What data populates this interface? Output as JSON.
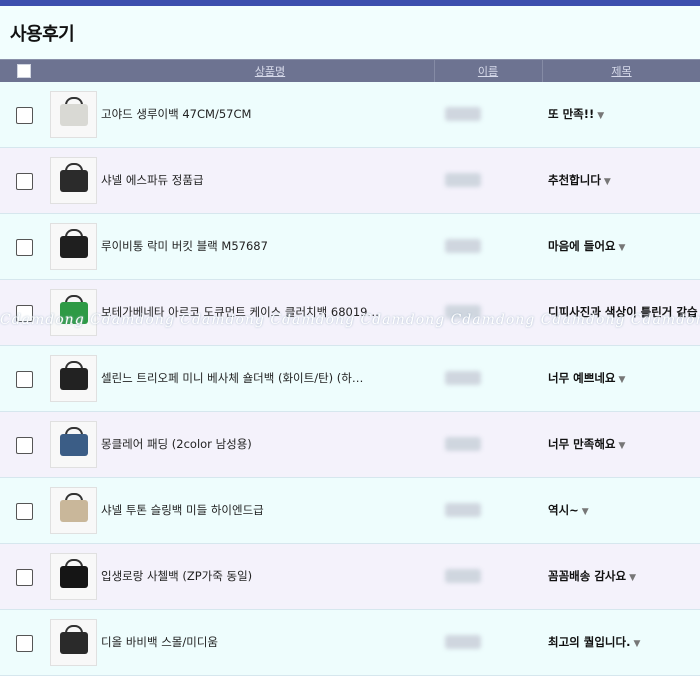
{
  "page": {
    "title": "사용후기"
  },
  "table": {
    "headers": {
      "product": "상품명",
      "name": "이름",
      "title": "제목"
    },
    "rows": [
      {
        "product": "고야드 생루이백 47CM/57CM",
        "title": "또 만족!!",
        "thumb_color": "#d9d9d4"
      },
      {
        "product": "샤넬 에스파듀 정품급",
        "title": "추천합니다",
        "thumb_color": "#2b2b2b"
      },
      {
        "product": "루이비통 락미 버킷 블랙 M57687",
        "title": "마음에 들어요",
        "thumb_color": "#1f1f1f"
      },
      {
        "product": "보테가베네타 아르코 도큐먼트 케이스 클러치백 68019…",
        "title": "디피사진과 색상이 틀린거 같습",
        "thumb_color": "#2e9a45"
      },
      {
        "product": "셀린느 트리오페 미니 베사체 숄더백 (화이트/탄) (하…",
        "title": "너무 예쁘네요",
        "thumb_color": "#222222"
      },
      {
        "product": "몽클레어 패딩 (2color 남성용)",
        "title": "너무 만족해요",
        "thumb_color": "#3b5d86"
      },
      {
        "product": "샤넬 투톤 슬링백 미들 하이엔드급",
        "title": "역시~",
        "thumb_color": "#c9b79a"
      },
      {
        "product": "입생로랑 사첼백 (ZP가죽 동일)",
        "title": "꼼꼼배송 감사요",
        "thumb_color": "#151515"
      },
      {
        "product": "디올 바비백 스몰/미디움",
        "title": "최고의 퀄입니다.",
        "thumb_color": "#2a2a2a"
      }
    ]
  },
  "watermark": "Cdamdong Cdamdong Cdamdong Cdamdong Cdamdong Cdamdong Cdamdong Cdamdong",
  "icons": {
    "checkbox": "checkbox-icon",
    "caret": "caret-down-icon"
  },
  "colors": {
    "accent": "#3c4fae",
    "header_bg": "#6d7391"
  }
}
